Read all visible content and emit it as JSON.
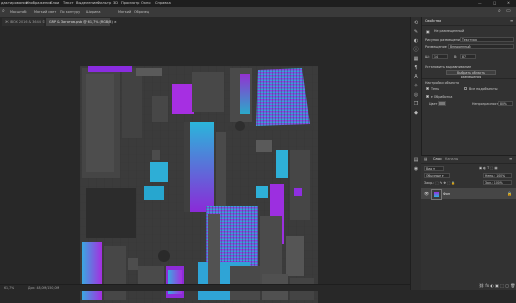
{
  "menu": {
    "items": [
      "дактирование",
      "Изображение",
      "Слои",
      "Текст",
      "Выделение",
      "Фильтр",
      "3D",
      "Просмотр",
      "Окно",
      "Справка"
    ]
  },
  "options": {
    "sample_label": "Масштаб:",
    "items": [
      "Мягкий свет",
      "По контуру",
      "Ширина",
      "Мягкий",
      "Образец"
    ]
  },
  "tabs": [
    {
      "label": "Ж IBOX 2016 & 3644 © ×",
      "active": false
    },
    {
      "label": "GRP & Заготов.psb @ 61,7% (RGB/8) ×",
      "active": true
    }
  ],
  "status": {
    "zoom": "61,7%",
    "doc_info": "Док: 48,0M/150,0M"
  },
  "properties": {
    "title": "Свойства",
    "row1": "Не размещенный",
    "layer_label": "Рисунок размещения",
    "layer_value": "Текстура",
    "layer2_label": "Размещение",
    "layer2_value": "Внедренный",
    "width_label": "Ш:",
    "width_value": "14",
    "height_label": "В:",
    "height_value": "87",
    "align_label": "Установить выравнивание",
    "select_label": "Выбрать область размещения",
    "extra_label": "Настройки объекта",
    "bg_label": "Тень",
    "bg_value": "Все подобъекты",
    "check2_label": "Все подобъекты",
    "opacity_label": "Непрозрачность",
    "opacity_value": "80%",
    "fill_label": "Цвет"
  },
  "layers": {
    "tab1": "Слои",
    "tab2": "Каналы",
    "layer_name": "Фон"
  },
  "colors": {
    "accent": "#8a2be2",
    "cyan": "#2ab0d8"
  }
}
